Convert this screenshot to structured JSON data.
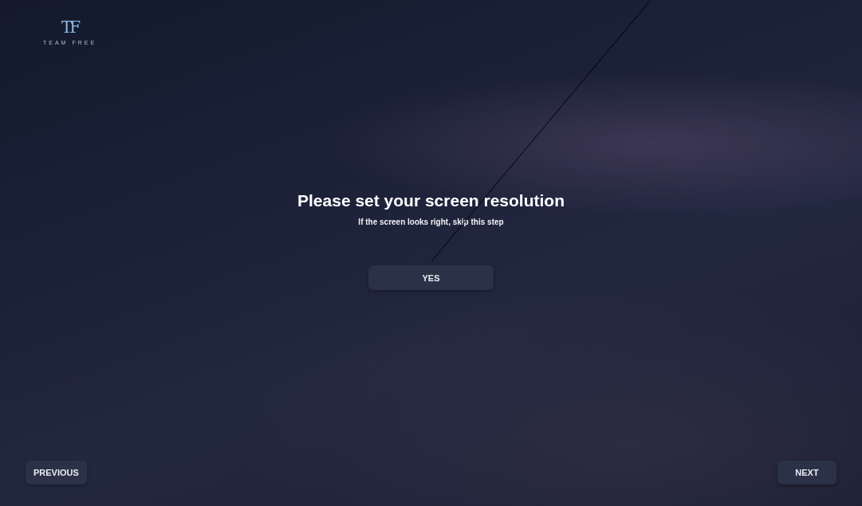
{
  "logo": {
    "mark": "TF",
    "name": "TEAM FREE"
  },
  "heading": "Please set your screen resolution",
  "subheading": "If the screen looks right, skip this step",
  "primary_button": "YES",
  "nav_buttons": [
    {
      "kind": "back",
      "label": "PREVIOUS"
    },
    {
      "kind": "forward",
      "label": "NEXT"
    }
  ]
}
